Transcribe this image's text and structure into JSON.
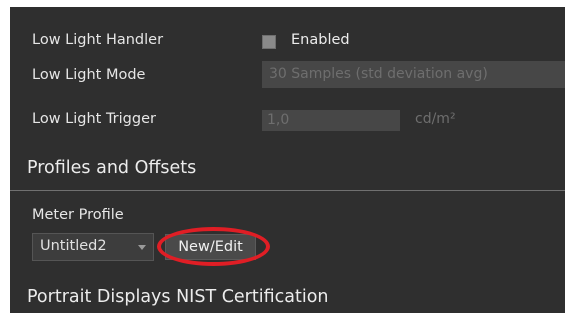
{
  "rows": {
    "low_light_handler": {
      "label": "Low Light Handler",
      "checkbox_label": "Enabled",
      "checked": true
    },
    "low_light_mode": {
      "label": "Low Light Mode",
      "value": "30 Samples (std deviation avg)"
    },
    "low_light_trigger": {
      "label": "Low Light Trigger",
      "value": "1,0",
      "unit": "cd/m²"
    }
  },
  "section_profiles": {
    "title": "Profiles and Offsets"
  },
  "meter_profile": {
    "label": "Meter Profile",
    "selected": "Untitled2",
    "button_label": "New/Edit"
  },
  "section_nist": {
    "title": "Portrait Displays NIST Certification"
  },
  "colors": {
    "panel_bg": "#2f2f2f",
    "field_bg": "#474747",
    "highlight_ring": "#e01e25"
  }
}
